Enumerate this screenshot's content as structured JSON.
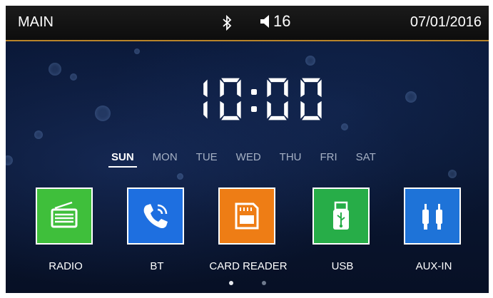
{
  "status": {
    "mode": "MAIN",
    "volume": "16",
    "date": "07/01/2016"
  },
  "clock": {
    "d1": "1",
    "d2": "0",
    "d3": "0",
    "d4": "0"
  },
  "days": [
    "SUN",
    "MON",
    "TUE",
    "WED",
    "THU",
    "FRI",
    "SAT"
  ],
  "active_day": "SUN",
  "apps": [
    {
      "label": "RADIO",
      "color": "#3fbf3b",
      "icon": "radio-icon"
    },
    {
      "label": "BT",
      "color": "#1e6fe0",
      "icon": "phone-icon"
    },
    {
      "label": "CARD READER",
      "color": "#ee7d15",
      "icon": "sd-card-icon"
    },
    {
      "label": "USB",
      "color": "#27ad48",
      "icon": "usb-icon"
    },
    {
      "label": "AUX-IN",
      "color": "#1e73d8",
      "icon": "aux-cable-icon"
    }
  ],
  "pager": {
    "current": 1,
    "total": 2
  }
}
